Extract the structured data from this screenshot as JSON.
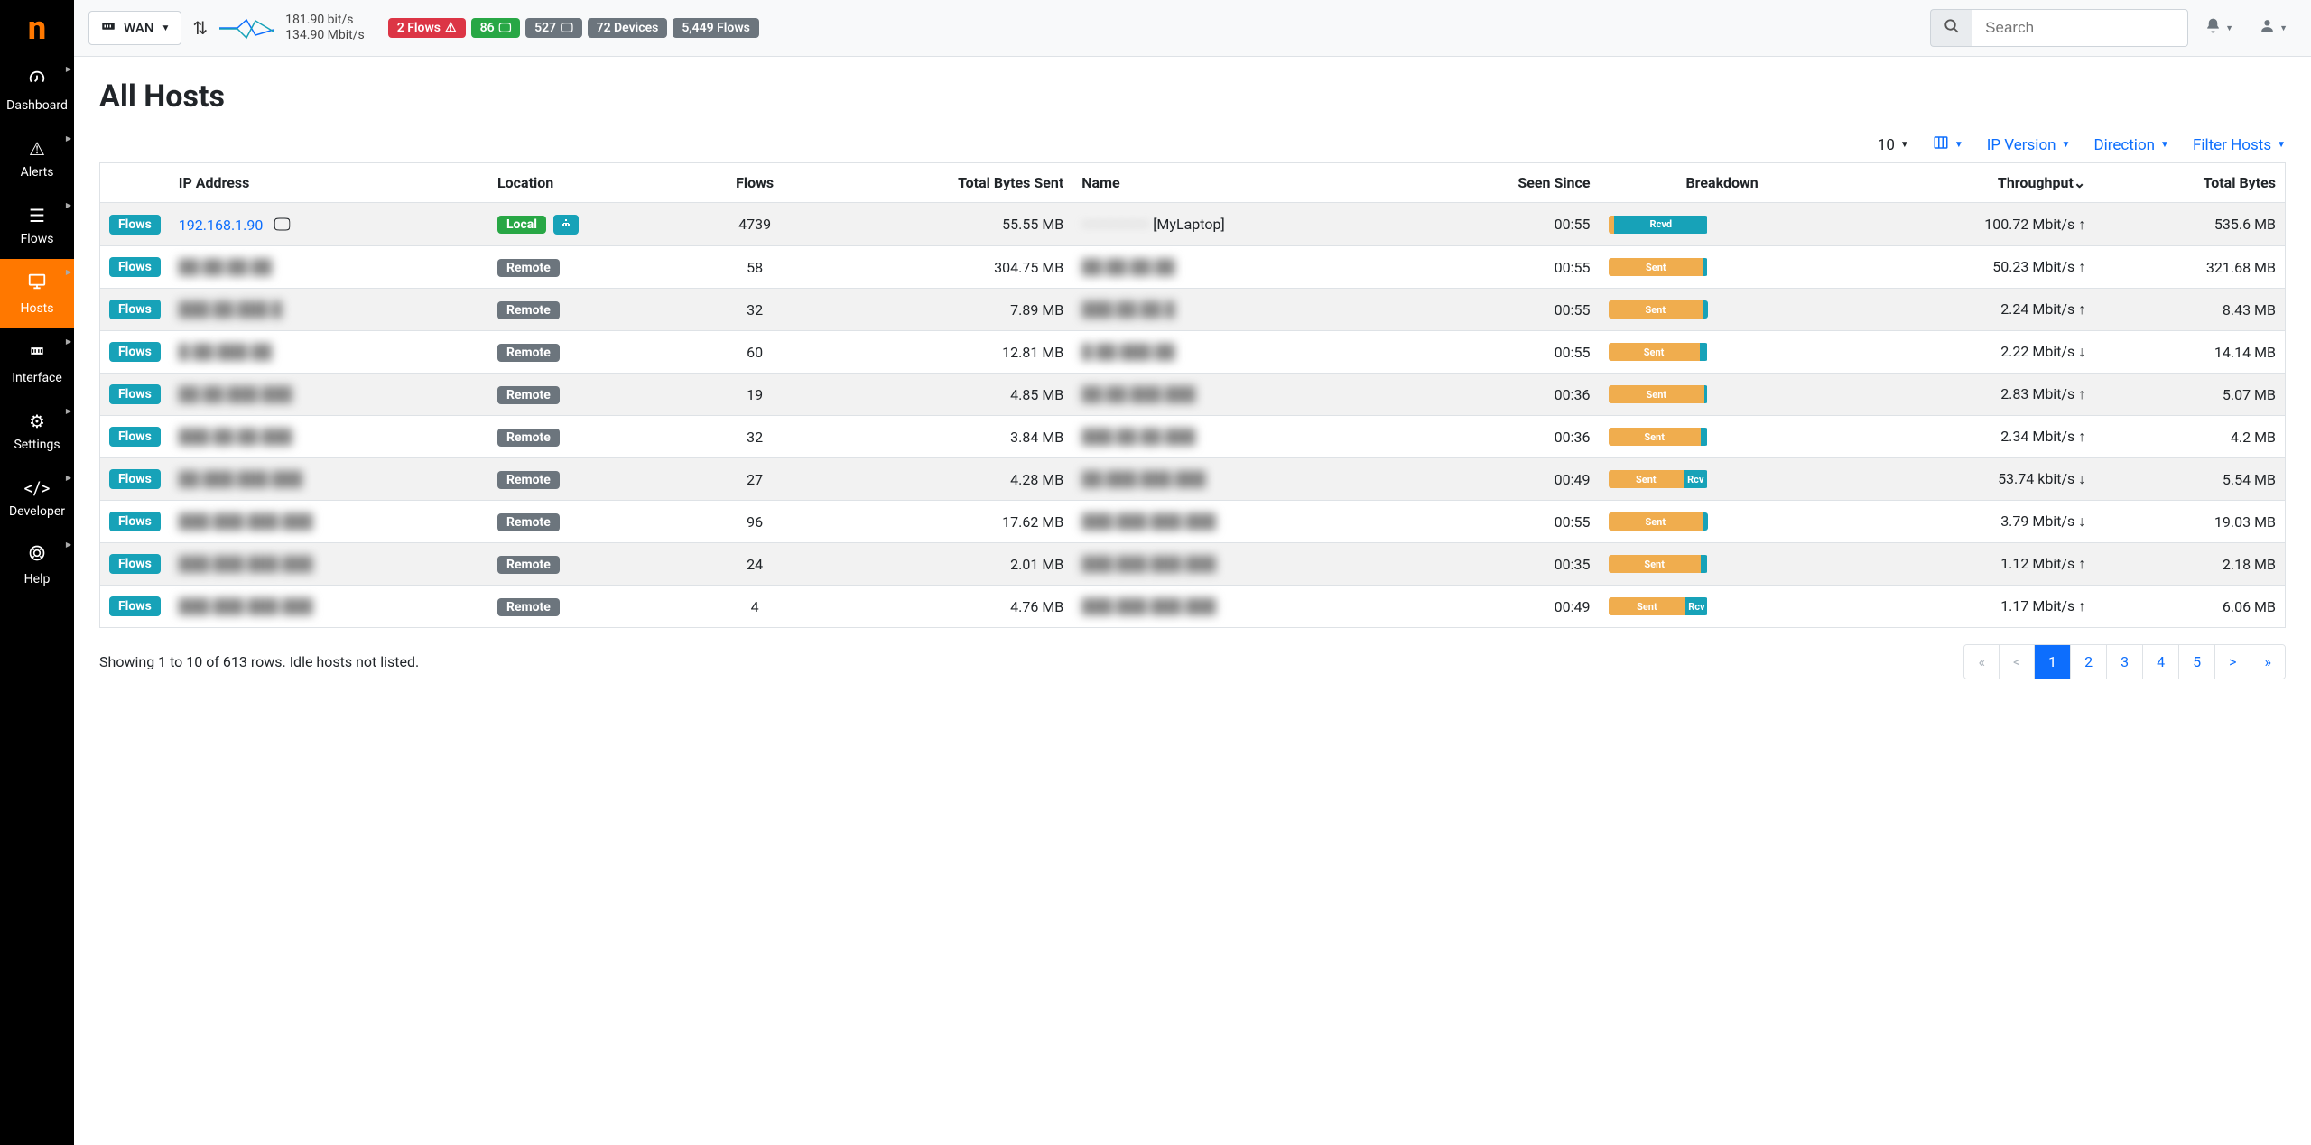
{
  "sidebar": {
    "items": [
      {
        "label": "Dashboard"
      },
      {
        "label": "Alerts"
      },
      {
        "label": "Flows"
      },
      {
        "label": "Hosts"
      },
      {
        "label": "Interface"
      },
      {
        "label": "Settings"
      },
      {
        "label": "Developer"
      },
      {
        "label": "Help"
      }
    ]
  },
  "topbar": {
    "interface": "WAN",
    "rate_up": "181.90 bit/s",
    "rate_down": "134.90 Mbit/s",
    "badges": {
      "flows_alert": "2 Flows",
      "hosts_ok": "86",
      "hosts_remote": "527",
      "devices": "72 Devices",
      "flows_total": "5,449 Flows"
    },
    "search_placeholder": "Search"
  },
  "page": {
    "title": "All Hosts",
    "filters": {
      "pagesize": "10",
      "ip_version": "IP Version",
      "direction": "Direction",
      "filter_hosts": "Filter Hosts"
    },
    "columns": {
      "ip": "IP Address",
      "location": "Location",
      "flows": "Flows",
      "bytes_sent": "Total Bytes Sent",
      "name": "Name",
      "seen_since": "Seen Since",
      "breakdown": "Breakdown",
      "throughput": "Throughput",
      "total_bytes": "Total Bytes"
    },
    "rows": [
      {
        "ip": "192.168.1.90",
        "ip_visible": true,
        "os_apple": true,
        "location": "Local",
        "local_extra": true,
        "flows": "4739",
        "bytes_sent": "55.55 MB",
        "name": "——————",
        "name_suffix": "[MyLaptop]",
        "seen": "00:55",
        "bd_sent_pct": 6,
        "bd_label": "Rcvd",
        "throughput": "100.72 Mbit/s",
        "arrow": "↑",
        "total": "535.6 MB"
      },
      {
        "ip": "██.██.██.██",
        "location": "Remote",
        "flows": "58",
        "bytes_sent": "304.75 MB",
        "name": "██.██.██.██",
        "seen": "00:55",
        "bd_sent_pct": 96,
        "bd_label": "Sent",
        "throughput": "50.23 Mbit/s",
        "arrow": "↑",
        "total": "321.68 MB"
      },
      {
        "ip": "███.██.███.█",
        "location": "Remote",
        "flows": "32",
        "bytes_sent": "7.89 MB",
        "name": "███.██.██.█",
        "seen": "00:55",
        "bd_sent_pct": 95,
        "bd_label": "Sent",
        "throughput": "2.24 Mbit/s",
        "arrow": "↑",
        "total": "8.43 MB"
      },
      {
        "ip": "█.██.███.██",
        "location": "Remote",
        "flows": "60",
        "bytes_sent": "12.81 MB",
        "name": "█.██.███.██",
        "seen": "00:55",
        "bd_sent_pct": 92,
        "bd_label": "Sent",
        "throughput": "2.22 Mbit/s",
        "arrow": "↓",
        "total": "14.14 MB"
      },
      {
        "ip": "██.██.███.███",
        "location": "Remote",
        "flows": "19",
        "bytes_sent": "4.85 MB",
        "name": "██.██.███.███",
        "seen": "00:36",
        "bd_sent_pct": 97,
        "bd_label": "Sent",
        "throughput": "2.83 Mbit/s",
        "arrow": "↑",
        "total": "5.07 MB"
      },
      {
        "ip": "███.██.██.███",
        "location": "Remote",
        "flows": "32",
        "bytes_sent": "3.84 MB",
        "name": "███.██.██.███",
        "seen": "00:36",
        "bd_sent_pct": 93,
        "bd_label": "Sent",
        "throughput": "2.34 Mbit/s",
        "arrow": "↑",
        "total": "4.2 MB"
      },
      {
        "ip": "██.███.███.███",
        "location": "Remote",
        "flows": "27",
        "bytes_sent": "4.28 MB",
        "name": "██.███.███.███",
        "seen": "00:49",
        "bd_sent_pct": 76,
        "bd_label": "Sent",
        "bd_rcv_label": "Rcv",
        "throughput": "53.74 kbit/s",
        "arrow": "↓",
        "total": "5.54 MB"
      },
      {
        "ip": "███.███.███.███",
        "location": "Remote",
        "flows": "96",
        "bytes_sent": "17.62 MB",
        "name": "███.███.███.███",
        "seen": "00:55",
        "bd_sent_pct": 95,
        "bd_label": "Sent",
        "throughput": "3.79 Mbit/s",
        "arrow": "↓",
        "total": "19.03 MB"
      },
      {
        "ip": "███.███.███.███",
        "location": "Remote",
        "flows": "24",
        "bytes_sent": "2.01 MB",
        "name": "███.███.███.███",
        "seen": "00:35",
        "bd_sent_pct": 93,
        "bd_label": "Sent",
        "throughput": "1.12 Mbit/s",
        "arrow": "↑",
        "total": "2.18 MB"
      },
      {
        "ip": "███.███.███.███",
        "location": "Remote",
        "flows": "4",
        "bytes_sent": "4.76 MB",
        "name": "███.███.███.███",
        "seen": "00:49",
        "bd_sent_pct": 78,
        "bd_label": "Sent",
        "bd_rcv_label": "Rcv",
        "throughput": "1.17 Mbit/s",
        "arrow": "↑",
        "total": "6.06 MB"
      }
    ],
    "footer": "Showing 1 to 10 of 613 rows. Idle hosts not listed.",
    "pagination": [
      "«",
      "<",
      "1",
      "2",
      "3",
      "4",
      "5",
      ">",
      "»"
    ],
    "pagination_active": "1"
  }
}
